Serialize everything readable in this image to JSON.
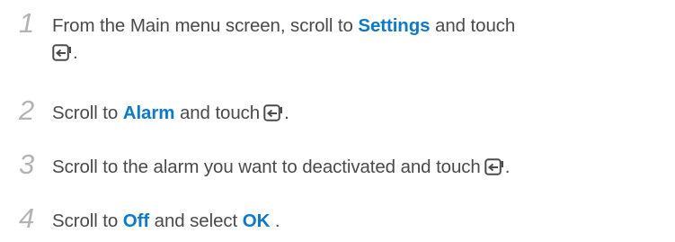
{
  "steps": [
    {
      "number": "1",
      "text_before": "From the Main menu screen, scroll to ",
      "highlight": "Settings",
      "text_after": " and touch",
      "icon": "enter-icon",
      "end": "."
    },
    {
      "number": "2",
      "text_before": "Scroll to ",
      "highlight": "Alarm",
      "text_after": " and touch",
      "icon": "enter-icon",
      "end": "."
    },
    {
      "number": "3",
      "text_before": "Scroll to the alarm you want to deactivated and touch",
      "icon": "enter-icon",
      "end": "."
    },
    {
      "number": "4",
      "text_before": "Scroll to ",
      "highlight": "Off",
      "text_middle": " and select ",
      "highlight2": "OK",
      "end": " ."
    }
  ],
  "colors": {
    "text": "#4a4a4a",
    "highlight": "#0a79d1",
    "step_number": "#b3b3b3"
  }
}
